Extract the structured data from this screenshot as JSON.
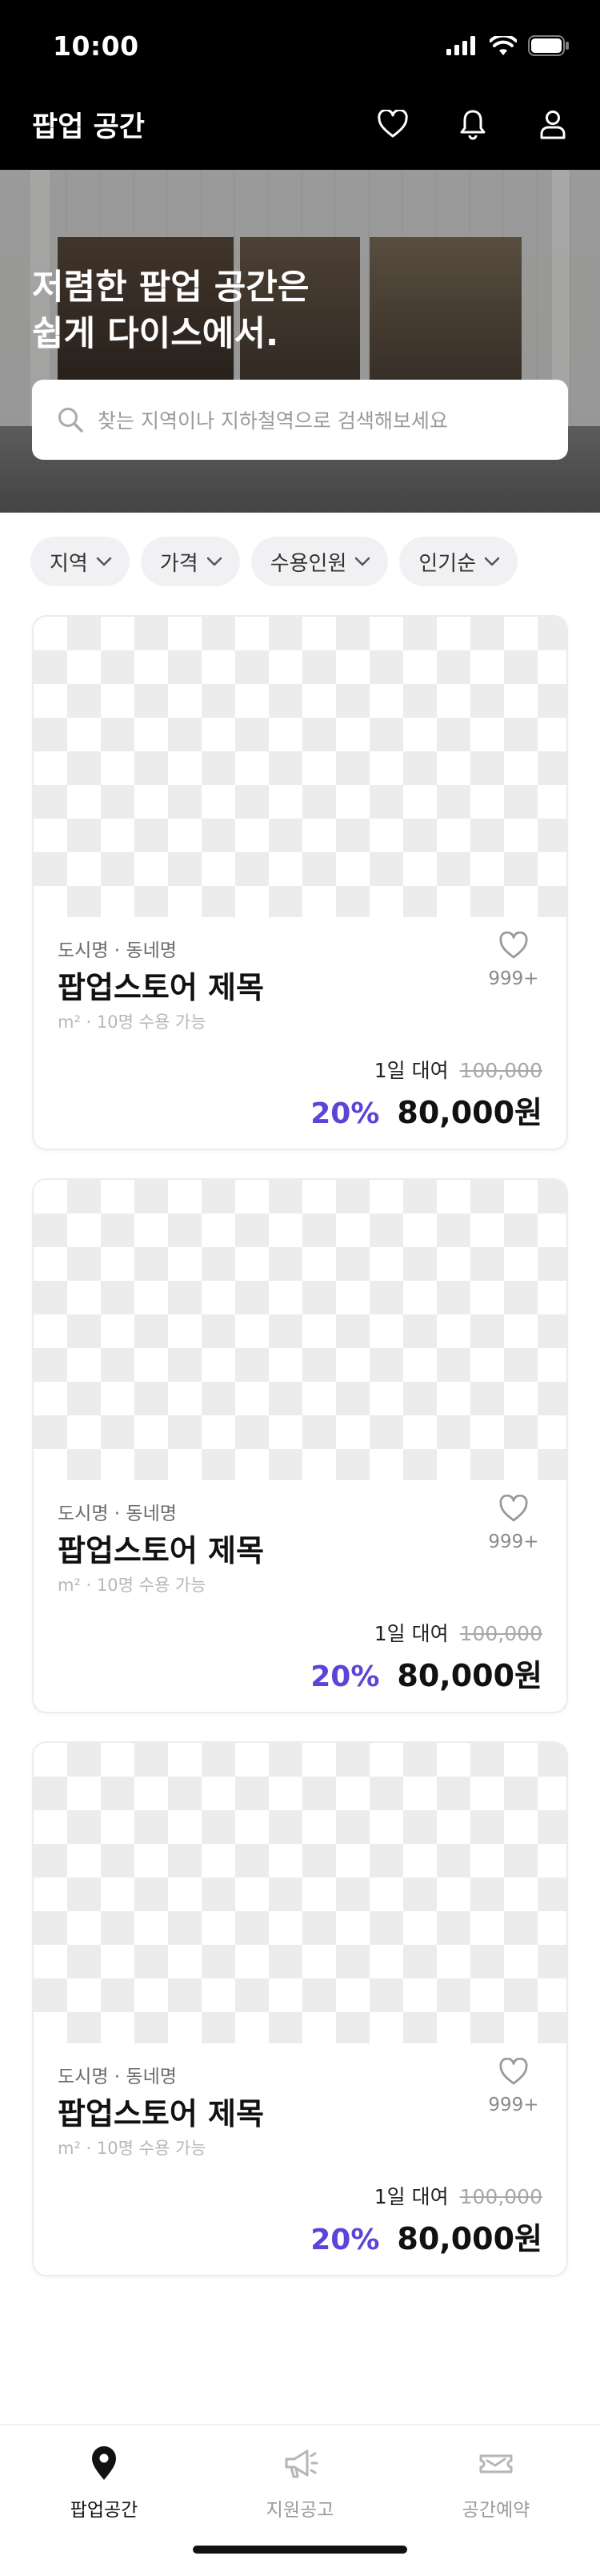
{
  "status_bar": {
    "time": "10:00"
  },
  "app_bar": {
    "title": "팝업 공간",
    "icons": [
      "heart-icon",
      "bell-icon",
      "user-icon"
    ]
  },
  "hero": {
    "headline": "저렴한 팝업 공간은\n쉽게 다이스에서.",
    "search_placeholder": "찾는 지역이나 지하철역으로 검색해보세요"
  },
  "filters": [
    {
      "label": "지역"
    },
    {
      "label": "가격"
    },
    {
      "label": "수용인원"
    },
    {
      "label": "인기순"
    }
  ],
  "listings": [
    {
      "location": "도시명 · 동네명",
      "title": "팝업스토어 제목",
      "capacity": "m² · 10명 수용 가능",
      "like_count": "999+",
      "rental_period": "1일 대여",
      "original_price": "100,000",
      "discount": "20%",
      "price": "80,000원"
    },
    {
      "location": "도시명 · 동네명",
      "title": "팝업스토어 제목",
      "capacity": "m² · 10명 수용 가능",
      "like_count": "999+",
      "rental_period": "1일 대여",
      "original_price": "100,000",
      "discount": "20%",
      "price": "80,000원"
    },
    {
      "location": "도시명 · 동네명",
      "title": "팝업스토어 제목",
      "capacity": "m² · 10명 수용 가능",
      "like_count": "999+",
      "rental_period": "1일 대여",
      "original_price": "100,000",
      "discount": "20%",
      "price": "80,000원"
    }
  ],
  "bottom_nav": {
    "items": [
      {
        "label": "팝업공간",
        "icon": "location-pin-icon",
        "active": true
      },
      {
        "label": "지원공고",
        "icon": "megaphone-icon",
        "active": false
      },
      {
        "label": "공간예약",
        "icon": "ticket-icon",
        "active": false
      }
    ]
  },
  "colors": {
    "accent": "#5b45d8",
    "header_bg": "#000000",
    "chip_bg": "#f1f1f3"
  }
}
